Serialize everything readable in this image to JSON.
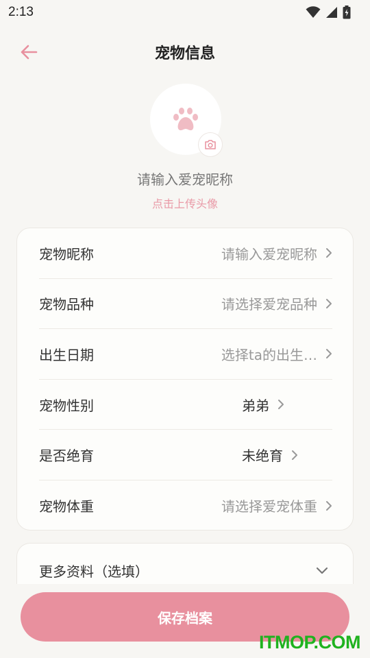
{
  "status_bar": {
    "time": "2:13"
  },
  "header": {
    "title": "宠物信息"
  },
  "profile": {
    "nickname_placeholder": "请输入爱宠昵称",
    "upload_hint": "点击上传头像"
  },
  "form": {
    "rows": [
      {
        "label": "宠物昵称",
        "value": "请输入爱宠昵称"
      },
      {
        "label": "宠物品种",
        "value": "请选择爱宠品种"
      },
      {
        "label": "出生日期",
        "value": "选择ta的出生…"
      },
      {
        "label": "宠物性别",
        "value": "弟弟"
      },
      {
        "label": "是否绝育",
        "value": "未绝育"
      },
      {
        "label": "宠物体重",
        "value": "请选择爱宠体重"
      }
    ]
  },
  "more": {
    "label": "更多资料（选填）"
  },
  "actions": {
    "save_label": "保存档案"
  },
  "watermark": "ITMOP.COM",
  "colors": {
    "accent": "#e8909e",
    "paw": "#f0bcc4"
  }
}
